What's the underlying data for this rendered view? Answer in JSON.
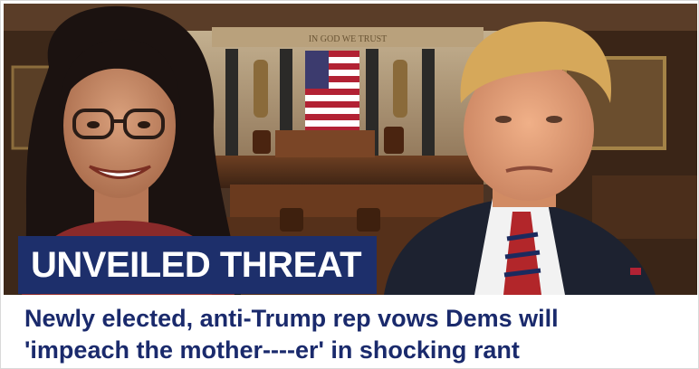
{
  "article": {
    "kicker": "UNVEILED THREAT",
    "headline_line1": "Newly elected, anti-Trump rep vows Dems will",
    "headline_line2": "'impeach the mother----er' in shocking rant",
    "chamber_inscription": "IN GOD WE TRUST"
  },
  "colors": {
    "kicker_bg": "#1d2f6b",
    "kicker_text": "#ffffff",
    "headline_text": "#1a2a6c"
  }
}
